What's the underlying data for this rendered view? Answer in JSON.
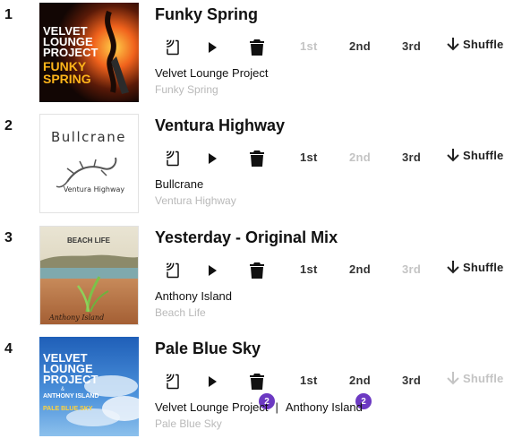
{
  "tracks": [
    {
      "number": "1",
      "title": "Funky Spring",
      "artists": [
        "Velvet Lounge Project"
      ],
      "album": "Funky Spring",
      "art_text": [
        "VELVET",
        "LOUNGE",
        "PROJECT",
        "FUNKY",
        "SPRING"
      ],
      "options": [
        "1st",
        "2nd",
        "3rd"
      ],
      "options_dim": [
        true,
        false,
        false
      ],
      "shuffle_label": "Shuffle",
      "shuffle_dim": false,
      "delete_dim": false,
      "badges": []
    },
    {
      "number": "2",
      "title": "Ventura Highway",
      "artists": [
        "Bullcrane"
      ],
      "album": "Ventura Highway",
      "art_text": [
        "Bullcrane",
        "Ventura Highway"
      ],
      "options": [
        "1st",
        "2nd",
        "3rd"
      ],
      "options_dim": [
        false,
        true,
        false
      ],
      "shuffle_label": "Shuffle",
      "shuffle_dim": false,
      "delete_dim": false,
      "badges": []
    },
    {
      "number": "3",
      "title": "Yesterday - Original Mix",
      "artists": [
        "Anthony Island"
      ],
      "album": "Beach Life",
      "art_text": [
        "BEACH LIFE",
        "Anthony Island"
      ],
      "options": [
        "1st",
        "2nd",
        "3rd"
      ],
      "options_dim": [
        false,
        false,
        true
      ],
      "shuffle_label": "Shuffle",
      "shuffle_dim": false,
      "delete_dim": false,
      "badges": []
    },
    {
      "number": "4",
      "title": "Pale Blue Sky",
      "artists": [
        "Velvet Lounge Project",
        "Anthony Island"
      ],
      "separator": "|",
      "album": "Pale Blue Sky",
      "art_text": [
        "VELVET",
        "LOUNGE",
        "PROJECT",
        "&",
        "ANTHONY ISLAND",
        "PALE BLUE SKY"
      ],
      "options": [
        "1st",
        "2nd",
        "3rd"
      ],
      "options_dim": [
        false,
        false,
        false
      ],
      "shuffle_label": "Shuffle",
      "shuffle_dim": true,
      "delete_dim": false,
      "badges": [
        "2",
        "2"
      ]
    }
  ],
  "icons": {
    "cast": "cast-icon",
    "play": "play-icon",
    "delete": "trash-icon",
    "shuffle": "arrow-down-icon"
  },
  "colors": {
    "accent_badge": "#6c39c2",
    "dim_text": "#c4c4c4",
    "album_text": "#b9b9b9"
  }
}
